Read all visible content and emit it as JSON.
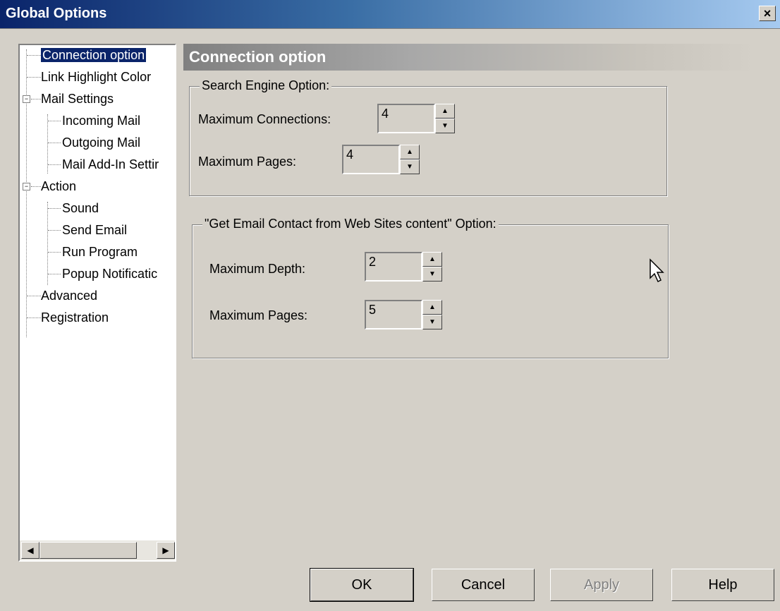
{
  "window": {
    "title": "Global Options",
    "close_label": "×"
  },
  "tree": {
    "items": [
      {
        "label": "Connection option",
        "selected": true
      },
      {
        "label": "Link Highlight Color"
      },
      {
        "label": "Mail Settings"
      },
      {
        "label": "Incoming Mail"
      },
      {
        "label": "Outgoing Mail"
      },
      {
        "label": "Mail Add-In Settir"
      },
      {
        "label": "Action"
      },
      {
        "label": "Sound"
      },
      {
        "label": "Send Email"
      },
      {
        "label": "Run Program"
      },
      {
        "label": "Popup Notificatic"
      },
      {
        "label": "Advanced"
      },
      {
        "label": "Registration"
      }
    ],
    "expander_symbol": "−"
  },
  "panel": {
    "title": "Connection option",
    "search_group": {
      "legend": "Search Engine Option:",
      "max_connections_label": "Maximum Connections:",
      "max_connections_value": "4",
      "max_pages_label": "Maximum Pages:",
      "max_pages_value": "4"
    },
    "email_group": {
      "legend": "\"Get Email Contact from Web Sites content\" Option:",
      "max_depth_label": "Maximum Depth:",
      "max_depth_value": "2",
      "max_pages_label": "Maximum Pages:",
      "max_pages_value": "5"
    }
  },
  "buttons": {
    "ok": "OK",
    "cancel": "Cancel",
    "apply": "Apply",
    "help": "Help"
  },
  "icons": {
    "spin_up": "▲",
    "spin_down": "▼",
    "scroll_left": "◀",
    "scroll_right": "▶"
  }
}
